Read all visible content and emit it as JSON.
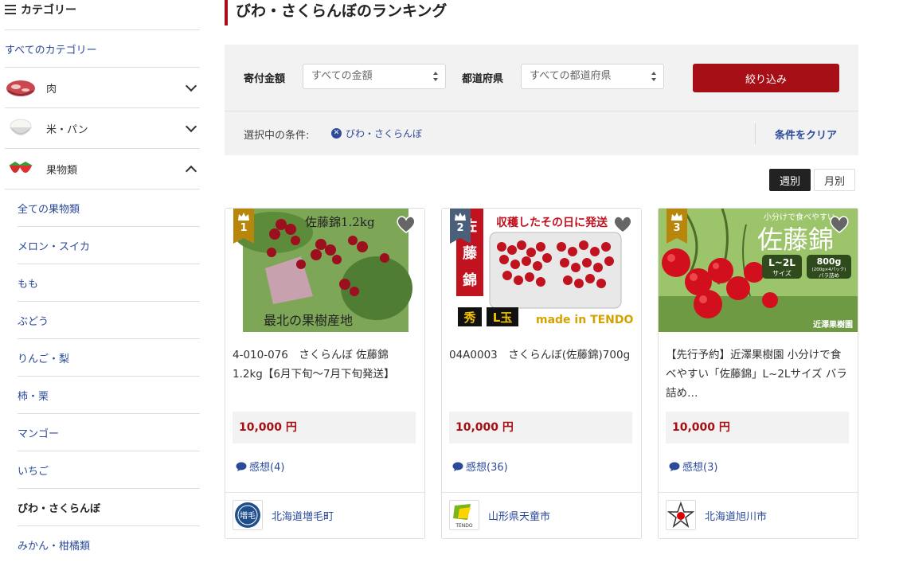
{
  "sidebar": {
    "header": "カテゴリー",
    "all_label": "すべてのカテゴリー",
    "categories": [
      {
        "label": "肉",
        "state": "collapsed"
      },
      {
        "label": "米・パン",
        "state": "collapsed"
      },
      {
        "label": "果物類",
        "state": "expanded"
      }
    ],
    "fruit_items": [
      {
        "label": "全ての果物類"
      },
      {
        "label": "メロン・スイカ"
      },
      {
        "label": "もも"
      },
      {
        "label": "ぶどう"
      },
      {
        "label": "りんご・梨"
      },
      {
        "label": "柿・栗"
      },
      {
        "label": "マンゴー"
      },
      {
        "label": "いちご"
      },
      {
        "label": "びわ・さくらんぼ",
        "active": true
      },
      {
        "label": "みかん・柑橘類"
      }
    ]
  },
  "page": {
    "title": "びわ・さくらんぼのランキング"
  },
  "filter": {
    "amount_label": "寄付金額",
    "amount_value": "すべての金額",
    "pref_label": "都道府県",
    "pref_value": "すべての都道府県",
    "submit_label": "絞り込み",
    "conditions_label": "選択中の条件:",
    "condition_chip": "びわ・さくらんぼ",
    "clear_label": "条件をクリア"
  },
  "tabs": {
    "weekly": "週別",
    "monthly": "月別",
    "selected": "weekly"
  },
  "cards": [
    {
      "rank": "1",
      "badge_color": "#b8860b",
      "image_text_top": "佐藤錦1.2kg",
      "image_text_bottom": "最北の果樹産地",
      "name": "4-010-076　さくらんぼ 佐藤錦1.2kg【6月下旬～7月下旬発送】",
      "price": "10,000 円",
      "review": "感想(4)",
      "municipality": "北海道増毛町",
      "logo": "増毛"
    },
    {
      "rank": "2",
      "badge_color": "#4a5f7a",
      "image_text_top": "収穫したその日に発送",
      "image_side": [
        "佐",
        "藤",
        "錦"
      ],
      "image_tag1": "秀",
      "image_tag2": "L玉",
      "image_text_bottom": "made in TENDO",
      "name": "04A0003　さくらんぼ(佐藤錦)700g",
      "price": "10,000 円",
      "review": "感想(36)",
      "municipality": "山形県天童市",
      "logo": "TENDO"
    },
    {
      "rank": "3",
      "badge_color": "#b8860b",
      "image_text_small": "小分けで食べやすい",
      "image_text_big": "佐藤錦",
      "image_size": "L~2L",
      "image_size_sub": "サイズ",
      "image_weight": "800g",
      "image_weight_sub1": "(200g×4パック)",
      "image_weight_sub2": "バラ詰め",
      "image_brand": "近澤果樹園",
      "name": "【先行予約】近澤果樹園 小分けで食べやすい「佐藤錦」L~2Lサイズ バラ詰め…",
      "price": "10,000 円",
      "review": "感想(3)",
      "municipality": "北海道旭川市"
    }
  ],
  "colors": {
    "accent": "#a50f15",
    "link": "#2b4a9a",
    "panel": "#f2f2f2"
  }
}
